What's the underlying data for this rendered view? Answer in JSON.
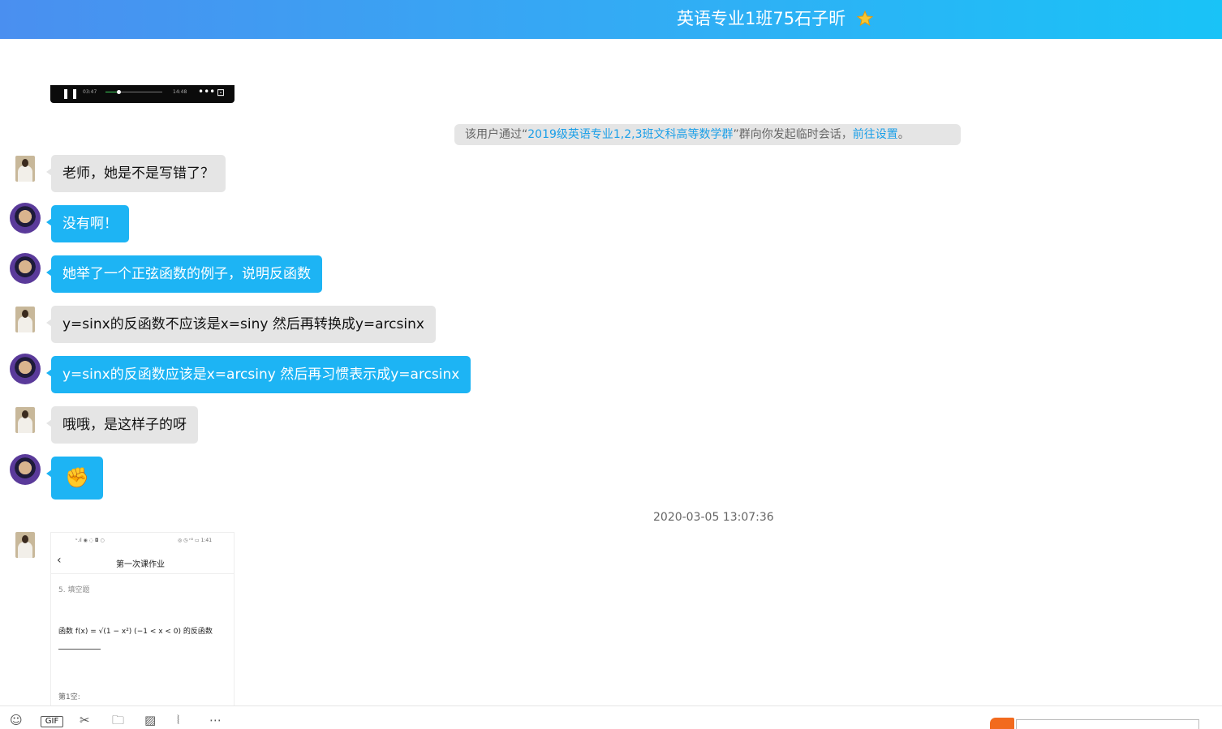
{
  "header": {
    "title": "英语专业1班75石子昕",
    "star_icon": "star-icon",
    "colors": {
      "gradient_start": "#4a8ff0",
      "gradient_end": "#19c3f7"
    }
  },
  "video": {
    "pause_glyph": "❚❚",
    "current_time": "03:47",
    "total_time": "14:48",
    "progress_fraction": 0.23,
    "more_glyph": "•••",
    "fullscreen_glyph": "⊡"
  },
  "notice": {
    "prefix": "该用户通过“",
    "group_name": "2019级英语专业1,2,3班文科高等数学群",
    "middle": "”群向你发起临时会话，",
    "link": "前往设置",
    "suffix": "。"
  },
  "messages": [
    {
      "sender": "student",
      "text": "老师，她是不是写错了？"
    },
    {
      "sender": "teacher",
      "text": "没有啊！"
    },
    {
      "sender": "teacher",
      "text": "她举了一个正弦函数的例子，说明反函数"
    },
    {
      "sender": "student",
      "text": "y=sinx的反函数不应该是x=siny 然后再转换成y=arcsinx"
    },
    {
      "sender": "teacher",
      "text": "y=sinx的反函数应该是x=arcsiny 然后再习惯表示成y=arcsinx"
    },
    {
      "sender": "student",
      "text": "哦哦，是这样子的呀"
    },
    {
      "sender": "teacher",
      "text": "✊"
    }
  ],
  "timestamp": "2020-03-05 13:07:36",
  "screenshot": {
    "status_left": "ᵘ.ıl ◉ ◌ ◘ ○",
    "status_right": "◎ ◷ ⁿ⁵ ▭ 1:41",
    "back_glyph": "‹",
    "title": "第一次课作业",
    "question_number": "5. 填空题",
    "question_text": "函数 f(x) = √(1 − x²) (−1 < x < 0) 的反函数",
    "answer_label": "第1空:"
  },
  "toolbar": {
    "emoji_icon": "☺",
    "gif_label": "GIF",
    "scissors_icon": "✂",
    "folder_icon": "🗀",
    "image_icon": "▨",
    "shake_icon": "⦚",
    "more_icon": "⋯"
  }
}
